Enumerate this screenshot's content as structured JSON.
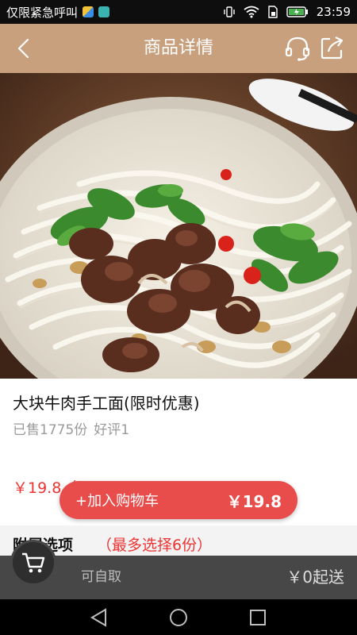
{
  "status_bar": {
    "carrier_text": "仅限紧急呼叫",
    "time": "23:59"
  },
  "header": {
    "title": "商品详情",
    "icons": [
      "back-arrow-icon",
      "headset-icon",
      "share-icon"
    ]
  },
  "product": {
    "name": "大块牛肉手工面(限时优惠)",
    "sold": "已售1775份",
    "rating": "好评1",
    "price_partial": "￥19.8（/"
  },
  "add_to_cart": {
    "label": "+加入购物车",
    "price": "￥19.8"
  },
  "attachments": {
    "title": "附属选项",
    "note": "（最多选择6份）"
  },
  "cart_bar": {
    "pickup": "可自取",
    "min_order": "￥0起送"
  },
  "colors": {
    "header_bg": "#c9a07d",
    "accent_red": "#e94d4b",
    "cart_bar_bg": "#474747"
  }
}
